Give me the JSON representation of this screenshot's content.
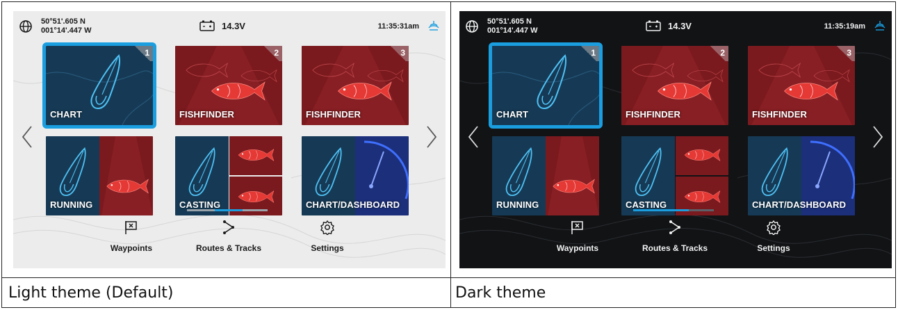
{
  "captions": {
    "light": "Light theme (Default)",
    "dark": "Dark theme"
  },
  "colors": {
    "selection": "#1a9ee0",
    "chart_tile": "#163a55",
    "fishfinder_tile": "#7a1a1e",
    "light_bg": "#ececec",
    "dark_bg": "#111315"
  },
  "icons": [
    "globe-icon",
    "battery-icon",
    "sonar-icon",
    "chevron-left-icon",
    "chevron-right-icon",
    "waypoint-flag-icon",
    "routes-icon",
    "gear-icon"
  ],
  "screens": {
    "light": {
      "status": {
        "lat": "50°51'.605 N",
        "lon": "001°14'.447 W",
        "voltage": "14.3V",
        "time": "11:35:31am"
      },
      "tiles": [
        {
          "label": "CHART",
          "num": "1"
        },
        {
          "label": "FISHFINDER",
          "num": "2"
        },
        {
          "label": "FISHFINDER",
          "num": "3"
        },
        {
          "label": "RUNNING"
        },
        {
          "label": "CASTING"
        },
        {
          "label": "CHART/DASHBOARD"
        }
      ],
      "dock": {
        "waypoints": "Waypoints",
        "routes": "Routes & Tracks",
        "settings": "Settings"
      }
    },
    "dark": {
      "status": {
        "lat": "50°51'.605 N",
        "lon": "001°14'.447 W",
        "voltage": "14.3V",
        "time": "11:35:19am"
      },
      "tiles": [
        {
          "label": "CHART",
          "num": "1"
        },
        {
          "label": "FISHFINDER",
          "num": "2"
        },
        {
          "label": "FISHFINDER",
          "num": "3"
        },
        {
          "label": "RUNNING"
        },
        {
          "label": "CASTING"
        },
        {
          "label": "CHART/DASHBOARD"
        }
      ],
      "dock": {
        "waypoints": "Waypoints",
        "routes": "Routes & Tracks",
        "settings": "Settings"
      }
    }
  }
}
